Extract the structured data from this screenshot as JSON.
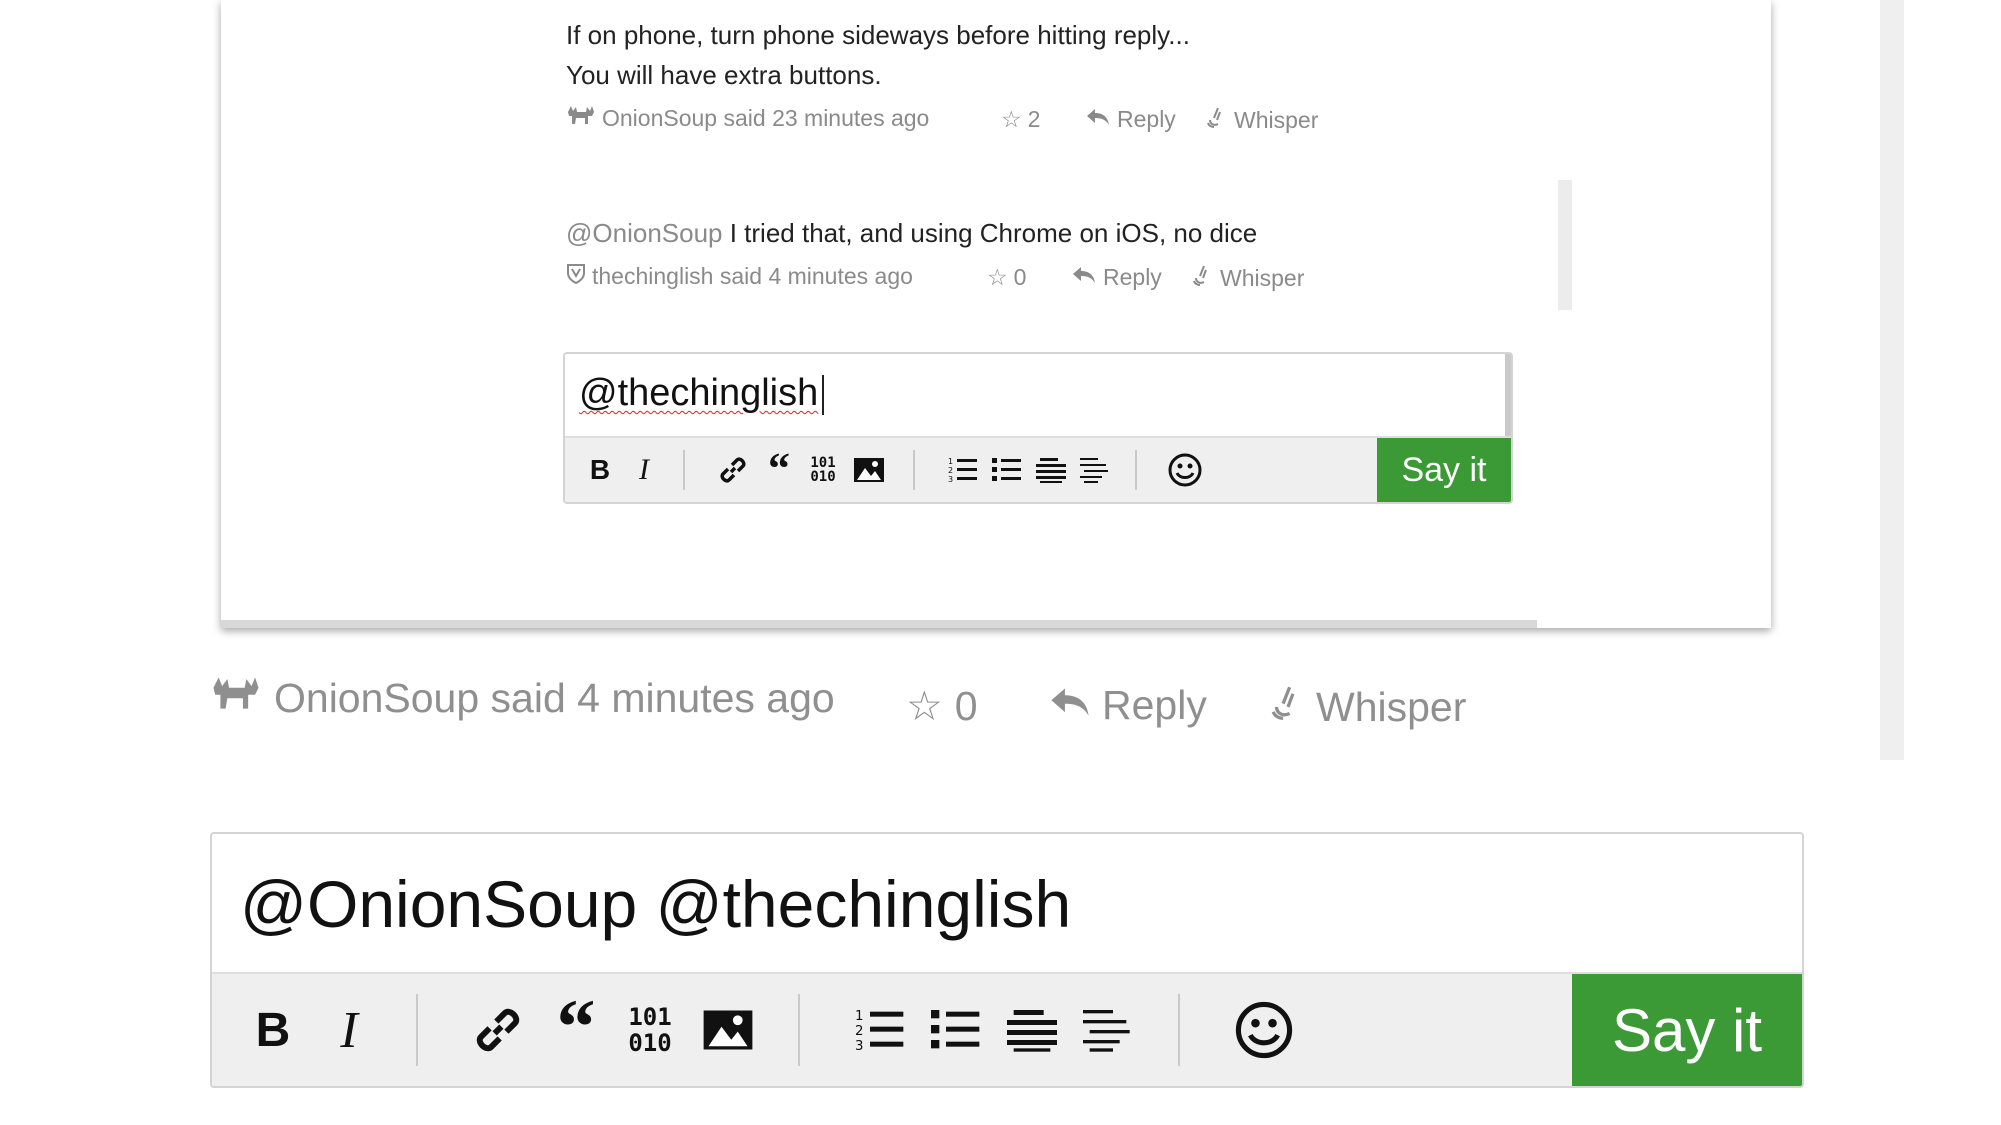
{
  "shot": {
    "comment1": {
      "line1": "If on phone, turn phone sideways before hitting reply...",
      "line2": "You will have extra buttons.",
      "author_meta": "OnionSoup said 23 minutes ago",
      "stars": "2",
      "reply": "Reply",
      "whisper": "Whisper"
    },
    "comment2": {
      "mention": "@OnionSoup",
      "text": " I tried that, and using Chrome on iOS, no dice",
      "author_meta": "thechinglish said 4 minutes ago",
      "stars": "0",
      "reply": "Reply",
      "whisper": "Whisper"
    },
    "editor": {
      "value": "@thechinglish",
      "say_it": "Say it"
    }
  },
  "main_comment": {
    "author_meta": "OnionSoup said 4 minutes ago",
    "stars": "0",
    "reply": "Reply",
    "whisper": "Whisper"
  },
  "reply_editor": {
    "value": "@OnionSoup @thechinglish",
    "say_it": "Say it",
    "toolbar_icons": [
      "bold-icon",
      "italic-icon",
      "link-icon",
      "quote-icon",
      "code-icon",
      "image-icon",
      "ordered-list-icon",
      "bullet-list-icon",
      "align-justify-icon",
      "align-left-icon",
      "emoji-icon"
    ]
  },
  "colors": {
    "accent_green": "#3c9a36",
    "meta_gray": "#8a8a8a",
    "toolbar_bg": "#efefef"
  }
}
